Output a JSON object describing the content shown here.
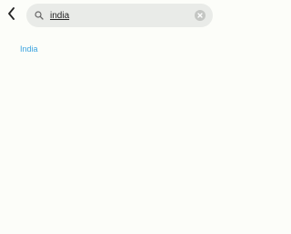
{
  "search": {
    "query": "india",
    "placeholder": ""
  },
  "results": {
    "items": [
      {
        "label": "India"
      }
    ]
  },
  "colors": {
    "accent": "#3aa3e0",
    "search_bg": "#e9ebe8",
    "page_bg": "#fcfdf9"
  },
  "icons": {
    "back": "chevron-left-icon",
    "search": "search-icon",
    "clear": "clear-icon"
  }
}
